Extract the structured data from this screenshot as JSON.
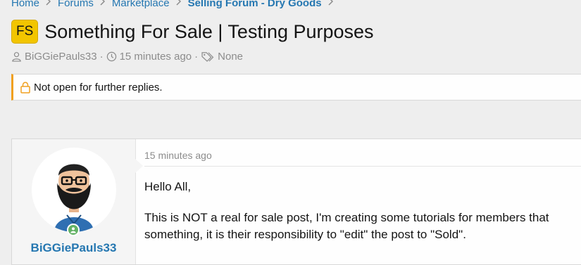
{
  "breadcrumb": {
    "items": [
      "Home",
      "Forums",
      "Marketplace",
      "Selling Forum - Dry Goods"
    ]
  },
  "thread": {
    "prefix": "FS",
    "title": "Something For Sale | Testing Purposes",
    "author": "BiGGiePauls33",
    "time": "15 minutes ago",
    "tags": "None"
  },
  "notice": {
    "text": "Not open for further replies."
  },
  "post": {
    "username": "BiGGiePauls33",
    "date": "15 minutes ago",
    "greeting": "Hello All,",
    "body_line1": "This is NOT a real for sale post, I'm creating some tutorials for members that",
    "body_line2": "something, it is their responsibility to \"edit\" the post to \"Sold\"."
  },
  "colors": {
    "link": "#2577b1",
    "prefix_badge": "#f2c500",
    "notice_accent": "#f0a020",
    "online": "#63b265"
  }
}
